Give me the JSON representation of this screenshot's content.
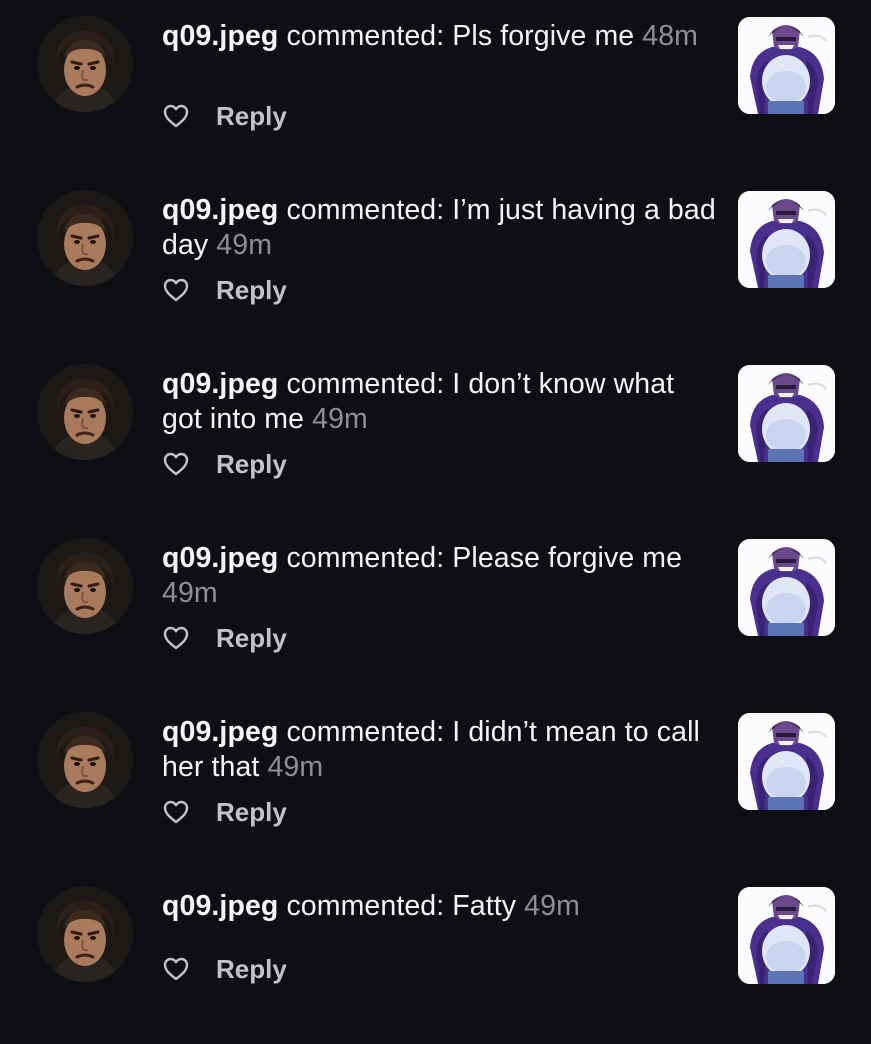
{
  "notifications": [
    {
      "username": "q09.jpeg",
      "action": " commented: ",
      "text": "Pls forgive me",
      "time": "48m",
      "reply_label": "Reply",
      "avatar_icon": "profile-avatar",
      "thumbnail_icon": "post-thumbnail"
    },
    {
      "username": "q09.jpeg",
      "action": " commented: ",
      "text": "I’m just having a bad day",
      "time": "49m",
      "reply_label": "Reply",
      "avatar_icon": "profile-avatar",
      "thumbnail_icon": "post-thumbnail"
    },
    {
      "username": "q09.jpeg",
      "action": " commented: ",
      "text": "I don’t know what got into me",
      "time": "49m",
      "reply_label": "Reply",
      "avatar_icon": "profile-avatar",
      "thumbnail_icon": "post-thumbnail"
    },
    {
      "username": "q09.jpeg",
      "action": " commented: ",
      "text": "Please forgive me",
      "time": "49m",
      "reply_label": "Reply",
      "avatar_icon": "profile-avatar",
      "thumbnail_icon": "post-thumbnail"
    },
    {
      "username": "q09.jpeg",
      "action": " commented: ",
      "text": "I didn’t mean to call her that",
      "time": "49m",
      "reply_label": "Reply",
      "avatar_icon": "profile-avatar",
      "thumbnail_icon": "post-thumbnail"
    },
    {
      "username": "q09.jpeg",
      "action": " commented: ",
      "text": "Fatty",
      "time": "49m",
      "reply_label": "Reply",
      "avatar_icon": "profile-avatar",
      "thumbnail_icon": "post-thumbnail"
    }
  ],
  "colors": {
    "background": "#0d0f14",
    "primary_text": "#f4f4f6",
    "secondary_text": "#8e8e94",
    "reply_text": "#c2c2c8",
    "thumbnail_purple": "#4a2f8f"
  }
}
